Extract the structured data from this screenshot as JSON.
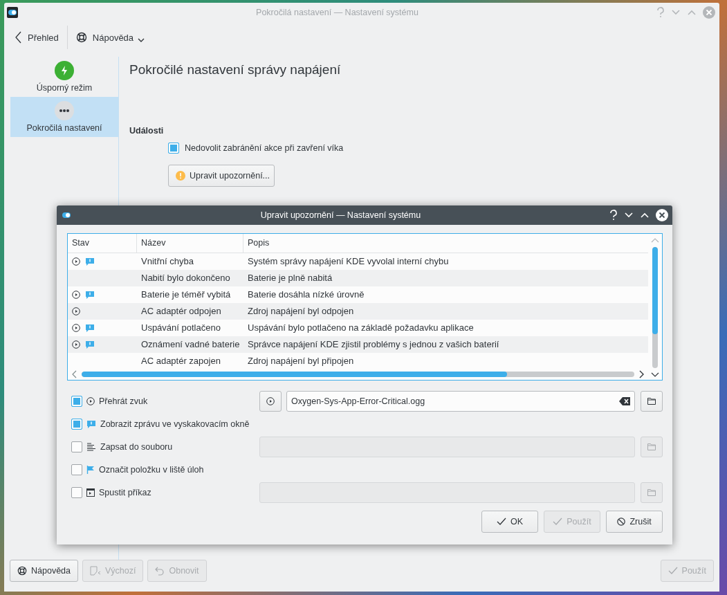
{
  "window": {
    "title": "Pokročilá nastavení  — Nastavení systému"
  },
  "toolbar": {
    "back": "Přehled",
    "help": "Nápověda"
  },
  "sidebar": {
    "items": [
      {
        "label": "Úsporný režim",
        "kind": "power",
        "selected": false
      },
      {
        "label": "Pokročilá nastavení",
        "kind": "more",
        "selected": true
      }
    ]
  },
  "page": {
    "heading": "Pokročilé nastavení správy napájení",
    "section": "Události",
    "checkbox": {
      "label": "Nedovolit zabránění akce při zavření víka",
      "checked": true
    },
    "button": "Upravit upozornění..."
  },
  "footer": {
    "buttons": [
      {
        "label": "Nápověda",
        "kind": "help",
        "disabled": false
      },
      {
        "label": "Výchozí",
        "kind": "defaults",
        "disabled": true
      },
      {
        "label": "Obnovit",
        "kind": "reset",
        "disabled": true
      },
      {
        "label": "Použít",
        "kind": "apply",
        "disabled": true
      }
    ]
  },
  "dialog": {
    "title": "Upravit upozornění — Nastavení systému",
    "table": {
      "columns": [
        "Stav",
        "Název",
        "Popis"
      ],
      "rows": [
        {
          "sound": true,
          "popup": true,
          "name": "Vnitřní chyba",
          "description": "Systém správy napájení KDE vyvolal interní chybu"
        },
        {
          "sound": false,
          "popup": false,
          "name": "Nabití bylo dokončeno",
          "description": "Baterie je plně nabitá"
        },
        {
          "sound": true,
          "popup": true,
          "name": "Baterie je téměř vybitá",
          "description": "Baterie dosáhla nízké úrovně"
        },
        {
          "sound": true,
          "popup": false,
          "name": "AC adaptér odpojen",
          "description": "Zdroj napájení byl odpojen"
        },
        {
          "sound": true,
          "popup": true,
          "name": "Uspávání potlačeno",
          "description": "Uspávání bylo potlačeno na základě požadavku aplikace"
        },
        {
          "sound": true,
          "popup": true,
          "name": "Oznámení vadné baterie",
          "description": "Správce napájení KDE zjistil problémy s jednou z vašich baterií"
        },
        {
          "sound": false,
          "popup": false,
          "name": "AC adaptér zapojen",
          "description": "Zdroj napájení byl připojen"
        }
      ]
    },
    "actions": [
      {
        "kind": "sound",
        "label": "Přehrát  zvuk",
        "checked": true,
        "value": "Oxygen-Sys-App-Error-Critical.ogg"
      },
      {
        "kind": "popup",
        "label": "Zobrazit zprávu ve vyskakovacím okně",
        "checked": true
      },
      {
        "kind": "file",
        "label": "Zapsat do souboru",
        "checked": false
      },
      {
        "kind": "taskbar",
        "label": "Označit položku v liště úloh",
        "checked": false
      },
      {
        "kind": "command",
        "label": "Spustit příkaz",
        "checked": false
      }
    ],
    "buttons": [
      {
        "label": "OK",
        "kind": "ok",
        "disabled": false
      },
      {
        "label": "Použít",
        "kind": "apply",
        "disabled": true
      },
      {
        "label": "Zrušit",
        "kind": "cancel",
        "disabled": false
      }
    ]
  }
}
